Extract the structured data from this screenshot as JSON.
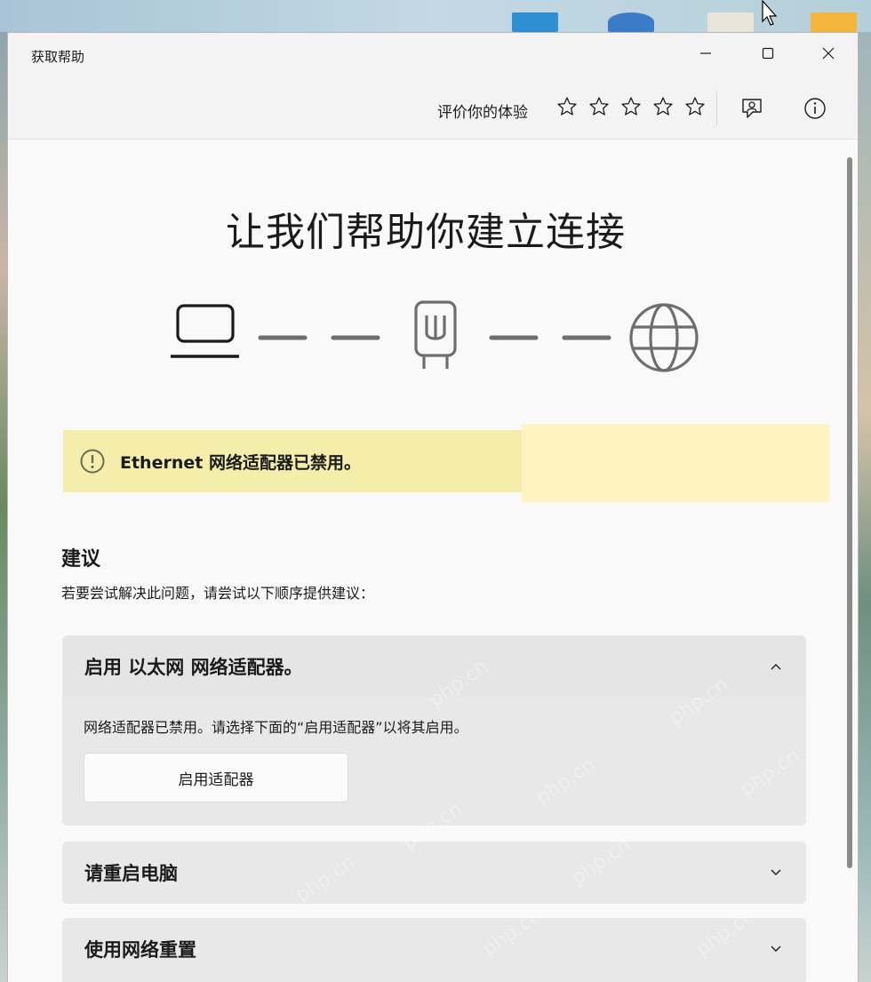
{
  "window": {
    "title": "获取帮助",
    "controls": {
      "minimize": "—",
      "maximize": "☐",
      "close": "✕"
    }
  },
  "toolbar": {
    "rating_label": "评价你的体验",
    "stars": [
      "star-1",
      "star-2",
      "star-3",
      "star-4",
      "star-5"
    ],
    "feedback_icon": "feedback-icon",
    "info_icon": "info-icon"
  },
  "main": {
    "heading": "让我们帮助你建立连接",
    "diagram_icons": [
      "laptop-icon",
      "ethernet-plug-icon",
      "globe-icon"
    ],
    "alert": {
      "icon": "warning-circle-icon",
      "text": "Ethernet 网络适配器已禁用。",
      "color": "#f4eeaa"
    },
    "suggestions": {
      "title": "建议",
      "subtitle": "若要尝试解决此问题，请尝试以下顺序提供建议："
    },
    "cards": [
      {
        "title": "启用 以太网 网络适配器。",
        "expanded": true,
        "description": "网络适配器已禁用。请选择下面的“启用适配器”以将其启用。",
        "button": "启用适配器"
      },
      {
        "title": "请重启电脑",
        "expanded": false
      },
      {
        "title": "使用网络重置",
        "expanded": false
      }
    ]
  },
  "watermark": "php.cn"
}
